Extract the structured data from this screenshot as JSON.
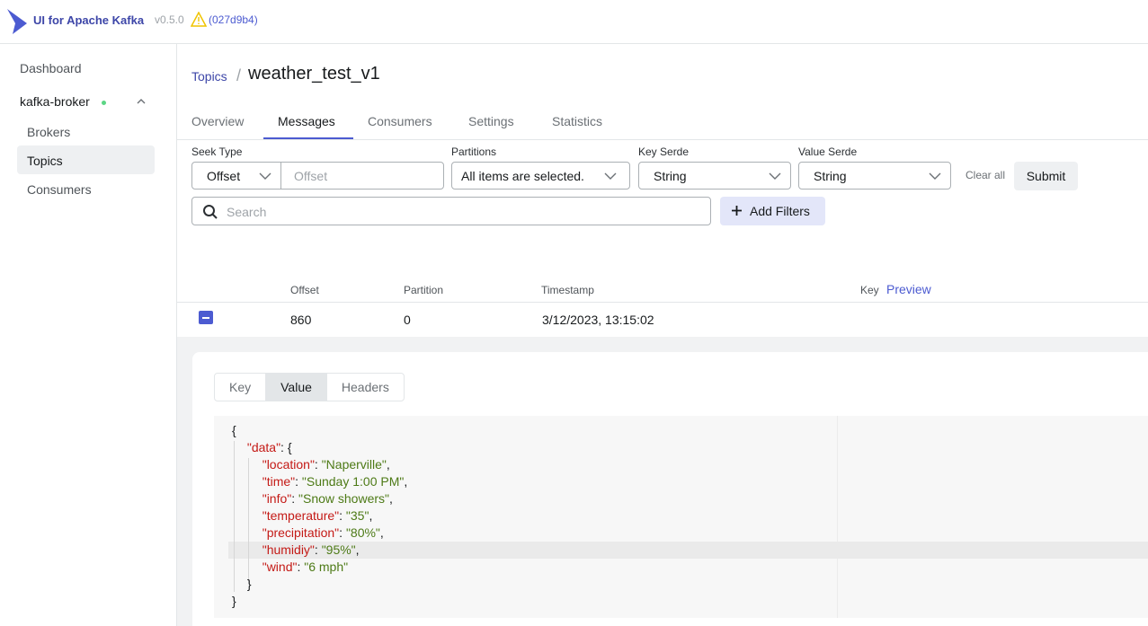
{
  "header": {
    "app_title": "UI for Apache Kafka",
    "version": "v0.5.0",
    "commit": "(027d9b4)"
  },
  "sidebar": {
    "dashboard": "Dashboard",
    "cluster": "kafka-broker",
    "items": [
      "Brokers",
      "Topics",
      "Consumers"
    ],
    "active": "Topics"
  },
  "breadcrumb": {
    "parent": "Topics",
    "separator": "/",
    "title": "weather_test_v1"
  },
  "tabs": [
    "Overview",
    "Messages",
    "Consumers",
    "Settings",
    "Statistics"
  ],
  "active_tab": "Messages",
  "filters": {
    "seek_type_label": "Seek Type",
    "seek_type_value": "Offset",
    "offset_placeholder": "Offset",
    "partitions_label": "Partitions",
    "partitions_value": "All items are selected.",
    "key_serde_label": "Key Serde",
    "key_serde_value": "String",
    "value_serde_label": "Value Serde",
    "value_serde_value": "String",
    "clear_all": "Clear all",
    "submit": "Submit",
    "search_placeholder": "Search",
    "add_filters": "Add Filters"
  },
  "table": {
    "headers": {
      "offset": "Offset",
      "partition": "Partition",
      "timestamp": "Timestamp",
      "key": "Key",
      "preview": "Preview"
    },
    "row": {
      "offset": "860",
      "partition": "0",
      "timestamp": "3/12/2023, 13:15:02"
    }
  },
  "message_view": {
    "tabs": [
      "Key",
      "Value",
      "Headers"
    ],
    "active": "Value",
    "json": {
      "root_key": "data",
      "fields": [
        {
          "key": "location",
          "value": "Naperville"
        },
        {
          "key": "time",
          "value": "Sunday 1:00 PM"
        },
        {
          "key": "info",
          "value": "Snow showers"
        },
        {
          "key": "temperature",
          "value": "35"
        },
        {
          "key": "precipitation",
          "value": "80%"
        },
        {
          "key": "humidiy",
          "value": "95%"
        },
        {
          "key": "wind",
          "value": "6 mph"
        }
      ]
    }
  },
  "colors": {
    "accent": "#4c5bd1",
    "brand": "#3d46a8",
    "online": "#5cd685",
    "json_key": "#c41a16",
    "json_string": "#4d7a16"
  },
  "icons": [
    "kafka-logo-icon",
    "warning-icon",
    "chevron-up-icon",
    "chevron-down-icon",
    "search-icon",
    "plus-icon",
    "collapse-icon"
  ]
}
